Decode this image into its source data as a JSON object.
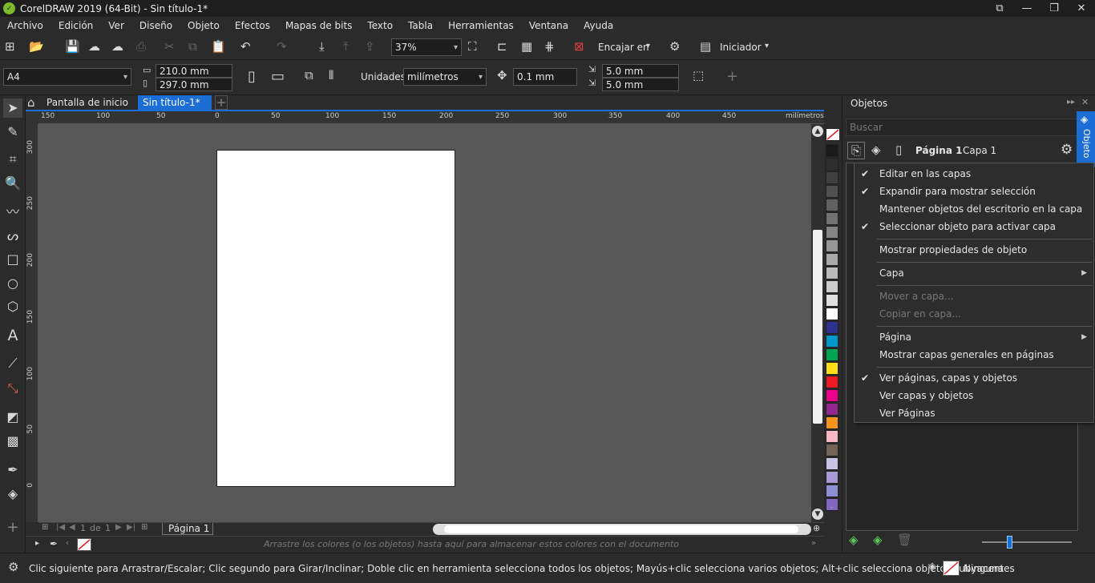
{
  "window": {
    "title": "CorelDRAW 2019 (64-Bit) - Sin título-1*"
  },
  "menubar": [
    "Archivo",
    "Edición",
    "Ver",
    "Diseño",
    "Objeto",
    "Efectos",
    "Mapas de bits",
    "Texto",
    "Tabla",
    "Herramientas",
    "Ventana",
    "Ayuda"
  ],
  "toolbar": {
    "zoom": "37%",
    "snap_label": "Encajar en",
    "launcher_label": "Iniciador"
  },
  "propbar": {
    "page_size": "A4",
    "width": "210.0 mm",
    "height": "297.0 mm",
    "units_label": "Unidades:",
    "units_value": "milímetros",
    "nudge": "0.1 mm",
    "dup_x": "5.0 mm",
    "dup_y": "5.0 mm"
  },
  "tabs": {
    "home": "Pantalla de inicio",
    "doc": "Sin título-1*"
  },
  "ruler": {
    "h_ticks": [
      "150",
      "100",
      "50",
      "0",
      "50",
      "100",
      "150",
      "200",
      "250",
      "300",
      "350",
      "400",
      "450"
    ],
    "h_unit": "milímetros",
    "v_ticks": [
      "300",
      "250",
      "200",
      "150",
      "100",
      "50",
      "0"
    ]
  },
  "pager": {
    "current": "1",
    "of_label": "de",
    "total": "1",
    "page_tab": "Página 1"
  },
  "colorstrip": {
    "hint": "Arrastre los colores (o los objetos) hasta aquí para almacenar estos colores con el documento"
  },
  "palette": [
    "#1a1a1a",
    "#2e2e2e",
    "#3f3f3f",
    "#505050",
    "#616161",
    "#727272",
    "#858585",
    "#969696",
    "#a8a8a8",
    "#bbbbbb",
    "#cdcdcd",
    "#dfdfdf",
    "#ffffff",
    "#2e3192",
    "#0099cc",
    "#00a651",
    "#ffde17",
    "#ed1c24",
    "#ec008c",
    "#92278f",
    "#f7941d",
    "#f9b7c3",
    "#736357",
    "#c9c3e6",
    "#a89ad6",
    "#8f8fd6",
    "#8066c0"
  ],
  "status": {
    "hint": "Clic siguiente para Arrastrar/Escalar; Clic segundo para Girar/Inclinar; Doble clic en herramienta selecciona todos los objetos; Mayús+clic selecciona varios objetos; Alt+clic selecciona objetos subyacentes",
    "fill": "Ninguna"
  },
  "objects_panel": {
    "title": "Objetos",
    "search_placeholder": "Buscar",
    "page": "Página 1",
    "layer": "Capa 1",
    "side_tab": "Objeto"
  },
  "context_menu": [
    {
      "label": "Editar en las capas",
      "checked": true,
      "disabled": false
    },
    {
      "label": "Expandir para mostrar selección",
      "checked": true,
      "disabled": false
    },
    {
      "label": "Mantener objetos del escritorio en la capa",
      "checked": false,
      "disabled": false
    },
    {
      "label": "Seleccionar objeto para activar capa",
      "checked": true,
      "disabled": false
    },
    {
      "label": "Mostrar propiedades de objeto",
      "checked": false,
      "disabled": false
    },
    {
      "label": "Capa",
      "checked": false,
      "disabled": false,
      "submenu": true
    },
    {
      "label": "Mover a capa...",
      "checked": false,
      "disabled": true
    },
    {
      "label": "Copiar en capa...",
      "checked": false,
      "disabled": true
    },
    {
      "label": "Página",
      "checked": false,
      "disabled": false,
      "submenu": true
    },
    {
      "label": "Mostrar capas generales en páginas",
      "checked": false,
      "disabled": false
    },
    {
      "label": "Ver páginas, capas y objetos",
      "checked": true,
      "disabled": false
    },
    {
      "label": "Ver capas y objetos",
      "checked": false,
      "disabled": false
    },
    {
      "label": "Ver Páginas",
      "checked": false,
      "disabled": false
    }
  ]
}
